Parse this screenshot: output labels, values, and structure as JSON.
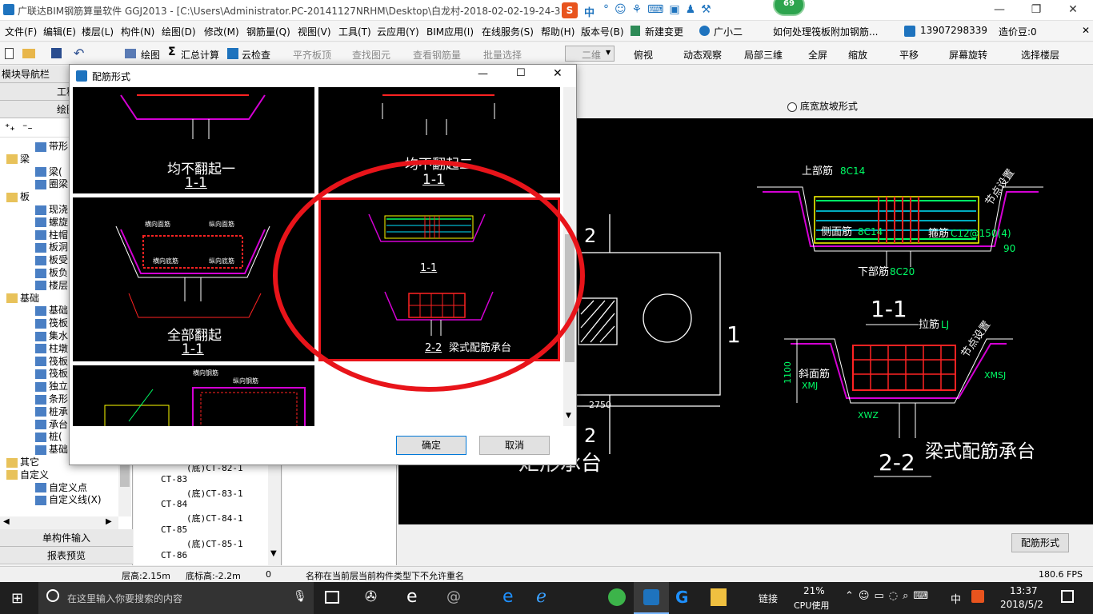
{
  "title_bar": {
    "app_title": "广联达BIM钢筋算量软件 GGJ2013 - [C:\\Users\\Administrator.PC-20141127NRHM\\Desktop\\白龙村-2018-02-02-19-24-35",
    "ime_label": "中",
    "badge_count": "69"
  },
  "menu": [
    "文件(F)",
    "编辑(E)",
    "楼层(L)",
    "构件(N)",
    "绘图(D)",
    "修改(M)",
    "钢筋量(Q)",
    "视图(V)",
    "工具(T)",
    "云应用(Y)",
    "BIM应用(I)",
    "在线服务(S)",
    "帮助(H)",
    "版本号(B)",
    "新建变更",
    "广小二",
    "如何处理筏板附加钢筋...",
    "13907298339",
    "造价豆:0"
  ],
  "toolbar": {
    "draw": "绘图",
    "sum": "汇总计算",
    "cloud_check": "云检查",
    "flat_top": "平齐板顶",
    "find_elem": "查找图元",
    "view_rebar": "查看钢筋量",
    "batch_select": "批量选择",
    "view_mode": "二维",
    "top_view": "俯视",
    "dynamic_view": "动态观察",
    "local_3d": "局部三维",
    "fullscreen": "全屏",
    "zoom": "缩放",
    "pan": "平移",
    "rotate": "屏幕旋转",
    "select_floor": "选择楼层"
  },
  "left_panel": {
    "header": "模块导航栏",
    "tab1": "工程",
    "tab2": "绘图",
    "tree": [
      {
        "label": "带形",
        "level": 2
      },
      {
        "label": "梁",
        "level": 1
      },
      {
        "label": "梁(",
        "level": 2
      },
      {
        "label": "圈梁",
        "level": 2
      },
      {
        "label": "板",
        "level": 1
      },
      {
        "label": "现浇",
        "level": 2
      },
      {
        "label": "螺旋",
        "level": 2
      },
      {
        "label": "柱帽",
        "level": 2
      },
      {
        "label": "板洞",
        "level": 2
      },
      {
        "label": "板受",
        "level": 2
      },
      {
        "label": "板负",
        "level": 2
      },
      {
        "label": "楼层",
        "level": 2
      },
      {
        "label": "基础",
        "level": 1
      },
      {
        "label": "基础",
        "level": 2
      },
      {
        "label": "筏板",
        "level": 2
      },
      {
        "label": "集水",
        "level": 2
      },
      {
        "label": "柱墩",
        "level": 2
      },
      {
        "label": "筏板",
        "level": 2
      },
      {
        "label": "筏板",
        "level": 2
      },
      {
        "label": "独立",
        "level": 2
      },
      {
        "label": "条形",
        "level": 2
      },
      {
        "label": "桩承",
        "level": 2
      },
      {
        "label": "承台",
        "level": 2
      },
      {
        "label": "桩(",
        "level": 2
      },
      {
        "label": "基础",
        "level": 2
      },
      {
        "label": "其它",
        "level": 1
      },
      {
        "label": "自定义",
        "level": 1
      },
      {
        "label": "自定义点",
        "level": 2
      },
      {
        "label": "自定义线(X)",
        "level": 2
      }
    ],
    "btn_single": "单构件输入",
    "btn_report": "报表预览"
  },
  "mid_tree": [
    "(底)CT-82-1",
    "CT-83",
    "(底)CT-83-1",
    "CT-84",
    "(底)CT-84-1",
    "CT-85",
    "(底)CT-85-1",
    "CT-86"
  ],
  "right": {
    "radio_label": "底宽放坡形式",
    "btn_form": "配筋形式",
    "drawing_texts": {
      "top_bar": "上部筋",
      "top_bar_val": "8C14",
      "side_bar": "侧面筋",
      "side_bar_val": "8C14",
      "stirrup": "箍筋",
      "stirrup_val": "C12@150(4)",
      "bottom_bar": "下部筋",
      "bottom_bar_val": "8C20",
      "section11": "1-1",
      "tie": "拉筋",
      "tie_val": "LJ",
      "slope_bar": "斜面筋",
      "xmj": "XMJ",
      "xmsj": "XMSJ",
      "xwz": "XWZ",
      "section22": "2-2",
      "beam_cap": "梁式配筋承台",
      "node_setting": "节点设置",
      "dim_1100": "1100",
      "dim_90": "90",
      "num_1": "1",
      "num_2": "2",
      "num_2b": "2",
      "dim_2750": "2750",
      "rect_cap": "矩形承台"
    }
  },
  "dialog": {
    "title": "配筋形式",
    "cells": [
      {
        "label": "均不翻起一",
        "section": "1-1"
      },
      {
        "label": "均不翻起二",
        "section": "1-1"
      },
      {
        "label": "全部翻起",
        "section": "1-1"
      },
      {
        "label": "梁式配筋承台",
        "section": "2-2",
        "section_top": "1-1"
      },
      {
        "label": "",
        "section": ""
      }
    ],
    "ok": "确定",
    "cancel": "取消",
    "labels_small": {
      "heng": "横向面筋",
      "zong": "纵向面筋",
      "hengdi": "横向底筋",
      "zongdi": "纵向底筋",
      "hengjin": "横向钢筋",
      "zongjin": "纵向钢筋"
    }
  },
  "status": {
    "floor_height": "层高:2.15m",
    "bottom_height": "底标高:-2.2m",
    "zero": "0",
    "message": "名称在当前层当前构件类型下不允许重名",
    "fps": "180.6 FPS"
  },
  "taskbar": {
    "search_placeholder": "在这里输入你要搜索的内容",
    "link": "链接",
    "cpu_pct": "21%",
    "cpu_label": "CPU使用",
    "lang": "中",
    "time": "13:37",
    "date": "2018/5/2"
  },
  "colors": {
    "accent": "#e81123",
    "circle": "#e8141a",
    "cad_bg": "#000000"
  }
}
